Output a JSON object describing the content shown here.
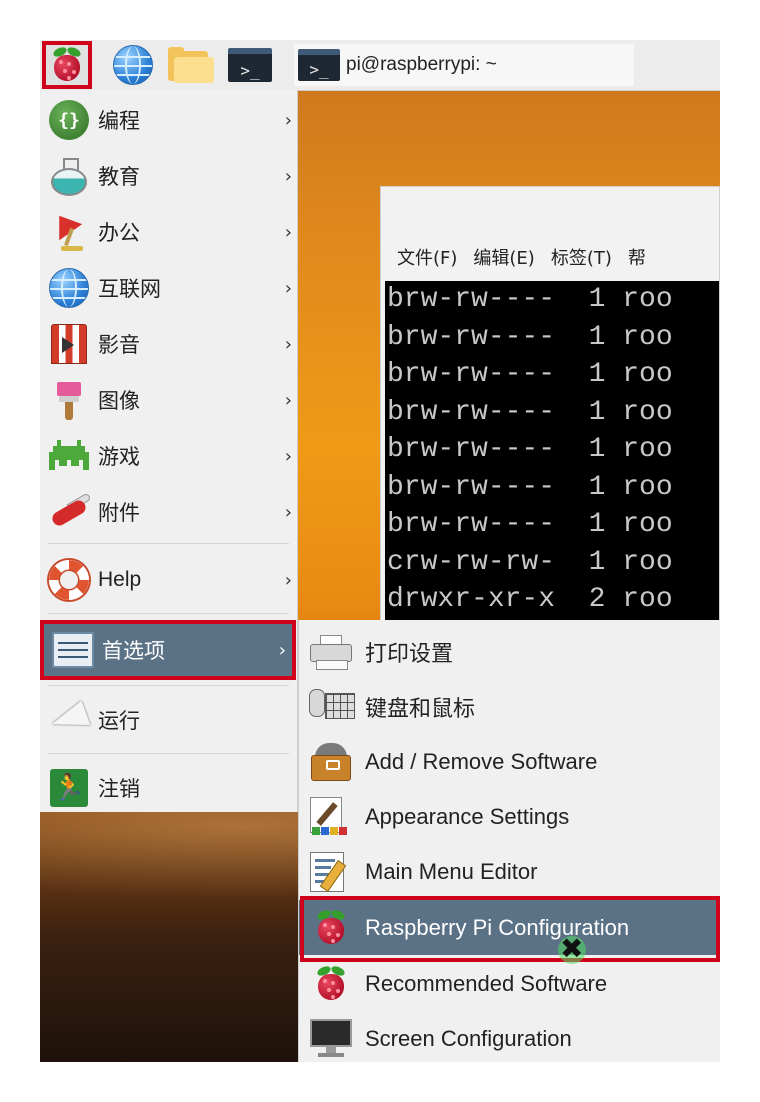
{
  "taskbar": {
    "window_title": "pi@raspberrypi: ~",
    "term_glyph": ">_"
  },
  "terminal": {
    "menu": [
      "文件(F)",
      "编辑(E)",
      "标签(T)",
      "帮"
    ],
    "lines": [
      "brw-rw----  1 roo",
      "brw-rw----  1 roo",
      "brw-rw----  1 roo",
      "brw-rw----  1 roo",
      "brw-rw----  1 roo",
      "brw-rw----  1 roo",
      "brw-rw----  1 roo",
      "crw-rw-rw-  1 roo",
      "drwxr-xr-x  2 roo"
    ]
  },
  "main_menu": {
    "arrow": "›",
    "items": [
      {
        "label": "编程",
        "icon": "programming-icon"
      },
      {
        "label": "教育",
        "icon": "education-icon"
      },
      {
        "label": "办公",
        "icon": "office-icon"
      },
      {
        "label": "互联网",
        "icon": "internet-icon"
      },
      {
        "label": "影音",
        "icon": "sound-video-icon"
      },
      {
        "label": "图像",
        "icon": "graphics-icon"
      },
      {
        "label": "游戏",
        "icon": "games-icon"
      },
      {
        "label": "附件",
        "icon": "accessories-icon"
      },
      {
        "label": "Help",
        "icon": "help-icon"
      },
      {
        "label": "首选项",
        "icon": "preferences-icon"
      },
      {
        "label": "运行",
        "icon": "run-icon"
      },
      {
        "label": "注销",
        "icon": "logout-icon"
      }
    ]
  },
  "submenu": {
    "items": [
      {
        "label": "打印设置",
        "icon": "printer-icon"
      },
      {
        "label": "键盘和鼠标",
        "icon": "keyboard-mouse-icon"
      },
      {
        "label": "Add / Remove Software",
        "icon": "package-icon"
      },
      {
        "label": "Appearance Settings",
        "icon": "appearance-icon"
      },
      {
        "label": "Main Menu Editor",
        "icon": "menu-editor-icon"
      },
      {
        "label": "Raspberry Pi Configuration",
        "icon": "raspberry-icon"
      },
      {
        "label": "Recommended Software",
        "icon": "raspberry-icon"
      },
      {
        "label": "Screen Configuration",
        "icon": "monitor-icon"
      }
    ]
  },
  "colors": {
    "highlight_border": "#d0021b",
    "selected_bg": "#5a7186"
  }
}
